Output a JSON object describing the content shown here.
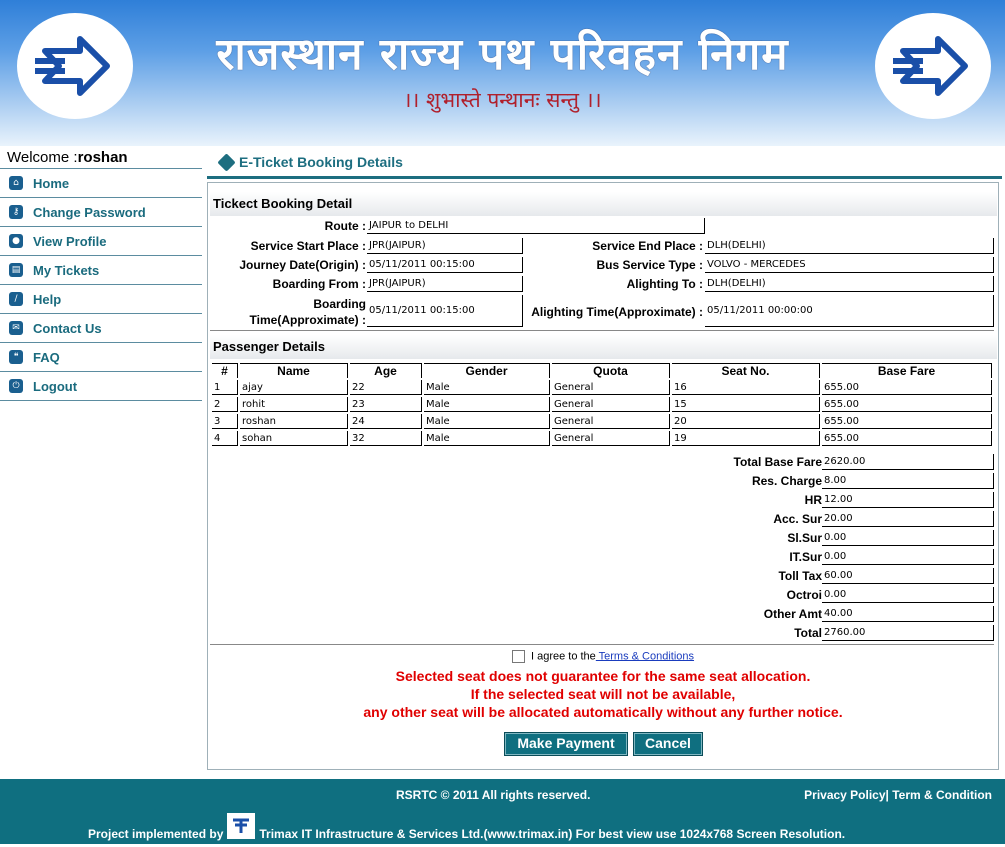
{
  "banner": {
    "title": "राजस्थान राज्य पथ परिवहन निगम",
    "motto": "।। शुभास्ते पन्थानः सन्तु ।।"
  },
  "welcome": {
    "prefix": "Welcome :",
    "user": "roshan"
  },
  "nav": [
    {
      "label": "Home",
      "icon": "home-icon"
    },
    {
      "label": "Change Password",
      "icon": "key-icon"
    },
    {
      "label": "View Profile",
      "icon": "user-icon"
    },
    {
      "label": "My Tickets",
      "icon": "ticket-icon"
    },
    {
      "label": "Help",
      "icon": "help-icon"
    },
    {
      "label": "Contact Us",
      "icon": "mail-icon"
    },
    {
      "label": "FAQ",
      "icon": "chat-icon"
    },
    {
      "label": "Logout",
      "icon": "power-icon"
    }
  ],
  "page_heading": "E-Ticket Booking Details",
  "booking": {
    "section_title": "Tickect Booking Detail",
    "route_label": "Route :",
    "route": "JAIPUR to DELHI",
    "service_start_label": "Service Start Place :",
    "service_start": "JPR(JAIPUR)",
    "service_end_label": "Service End Place :",
    "service_end": "DLH(DELHI)",
    "journey_date_label": "Journey Date(Origin) :",
    "journey_date": "05/11/2011 00:15:00",
    "bus_type_label": "Bus Service Type :",
    "bus_type": "VOLVO - MERCEDES",
    "boarding_from_label": "Boarding From :",
    "boarding_from": "JPR(JAIPUR)",
    "alighting_to_label": "Alighting To :",
    "alighting_to": "DLH(DELHI)",
    "boarding_time_label_1": "Boarding",
    "boarding_time_label_2": "Time(Approximate) :",
    "boarding_time": "05/11/2011 00:15:00",
    "alighting_time_label": "Alighting Time(Approximate) :",
    "alighting_time": "05/11/2011 00:00:00"
  },
  "passengers": {
    "section_title": "Passenger Details",
    "columns": [
      "#",
      "Name",
      "Age",
      "Gender",
      "Quota",
      "Seat No.",
      "Base Fare"
    ],
    "rows": [
      [
        "1",
        "ajay",
        "22",
        "Male",
        "General",
        "16",
        "655.00"
      ],
      [
        "2",
        "rohit",
        "23",
        "Male",
        "General",
        "15",
        "655.00"
      ],
      [
        "3",
        "roshan",
        "24",
        "Male",
        "General",
        "20",
        "655.00"
      ],
      [
        "4",
        "sohan",
        "32",
        "Male",
        "General",
        "19",
        "655.00"
      ]
    ]
  },
  "fares": [
    {
      "label": "Total Base Fare",
      "value": "2620.00"
    },
    {
      "label": "Res. Charge",
      "value": "8.00"
    },
    {
      "label": "HR",
      "value": "12.00"
    },
    {
      "label": "Acc. Sur",
      "value": "20.00"
    },
    {
      "label": "Sl.Sur",
      "value": "0.00"
    },
    {
      "label": "IT.Sur",
      "value": "0.00"
    },
    {
      "label": "Toll Tax",
      "value": "60.00"
    },
    {
      "label": "Octroi",
      "value": "0.00"
    },
    {
      "label": "Other Amt",
      "value": "40.00"
    },
    {
      "label": "Total",
      "value": "2760.00"
    }
  ],
  "agree": {
    "text": "I agree to the",
    "link": " Terms & Conditions"
  },
  "warning": [
    "Selected seat does not guarantee for the same seat allocation.",
    "If the selected seat will not be available,",
    "any other seat will be allocated automatically without any further notice."
  ],
  "buttons": {
    "pay": "Make Payment",
    "cancel": "Cancel"
  },
  "footer": {
    "copyright": "RSRTC © 2011 All rights reserved.",
    "privacy": "Privacy Policy",
    "divider": "|",
    "terms": " Term & Condition",
    "implemented_by": "Project implemented by",
    "company": "Trimax IT Infrastructure & Services Ltd.(www.trimax.in) For best view use 1024x768 Screen Resolution."
  },
  "colors": {
    "teal": "#0f6f80",
    "warning": "#e00000",
    "banner_blue": "#2f7fd8",
    "motto_red": "#b0202c"
  }
}
